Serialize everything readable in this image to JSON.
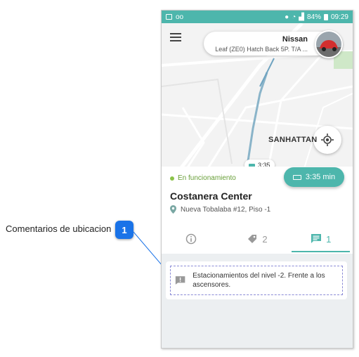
{
  "callout": {
    "label": "Comentarios de ubicacion",
    "badge": "1"
  },
  "status_bar": {
    "battery": "84%",
    "time": "09:29"
  },
  "car": {
    "brand": "Nissan",
    "model": "Leaf (ZE0) Hatch Back 5P. T/A ..."
  },
  "map": {
    "area_label": "SANHATTAN",
    "marker_time": "3:35",
    "charge_chip": "3:35 min"
  },
  "place": {
    "status": "En funcionamiento",
    "name": "Costanera Center",
    "address": "Nueva Tobalaba #12, Piso -1"
  },
  "tabs": [
    {
      "icon": "info-icon",
      "count": ""
    },
    {
      "icon": "tag-icon",
      "count": "2"
    },
    {
      "icon": "comment-icon",
      "count": "1"
    }
  ],
  "comment": {
    "text": "Estacionamientos del nivel -2. Frente a los ascensores."
  },
  "colors": {
    "accent": "#4db6ac",
    "status_green": "#8bc34a",
    "callout_blue": "#1a73e8"
  }
}
